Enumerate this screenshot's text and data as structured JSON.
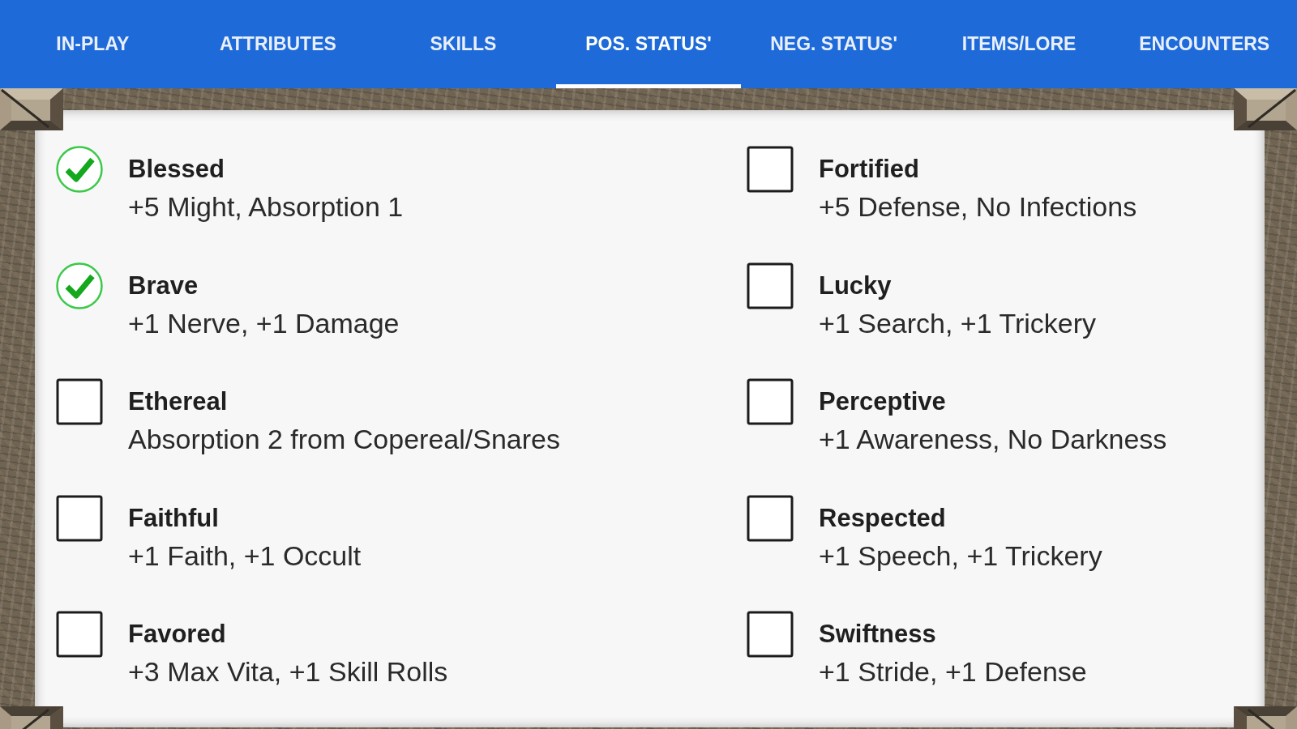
{
  "tabs": [
    {
      "label": "IN-PLAY",
      "selected": false
    },
    {
      "label": "ATTRIBUTES",
      "selected": false
    },
    {
      "label": "SKILLS",
      "selected": false
    },
    {
      "label": "POS. STATUS'",
      "selected": true
    },
    {
      "label": "NEG. STATUS'",
      "selected": false
    },
    {
      "label": "ITEMS/LORE",
      "selected": false
    },
    {
      "label": "ENCOUNTERS",
      "selected": false
    }
  ],
  "statuses": [
    {
      "name": "Blessed",
      "effect": "+5 Might, Absorption 1",
      "checked": true
    },
    {
      "name": "Brave",
      "effect": "+1 Nerve, +1 Damage",
      "checked": true
    },
    {
      "name": "Ethereal",
      "effect": "Absorption 2 from Copereal/Snares",
      "checked": false
    },
    {
      "name": "Faithful",
      "effect": "+1 Faith, +1 Occult",
      "checked": false
    },
    {
      "name": "Favored",
      "effect": "+3 Max Vita, +1 Skill Rolls",
      "checked": false
    },
    {
      "name": "Fortified",
      "effect": "+5 Defense, No Infections",
      "checked": false
    },
    {
      "name": "Lucky",
      "effect": "+1 Search, +1 Trickery",
      "checked": false
    },
    {
      "name": "Perceptive",
      "effect": "+1 Awareness, No Darkness",
      "checked": false
    },
    {
      "name": "Respected",
      "effect": "+1 Speech, +1 Trickery",
      "checked": false
    },
    {
      "name": "Swiftness",
      "effect": "+1 Stride, +1 Defense",
      "checked": false
    }
  ]
}
